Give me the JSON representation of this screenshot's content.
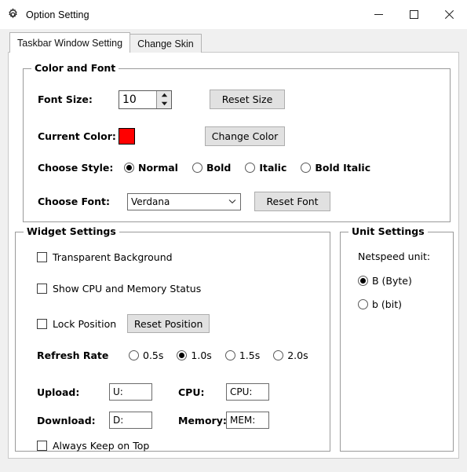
{
  "window": {
    "title": "Option Setting",
    "icon": "gear-icon",
    "controls": {
      "minimize": "minimize-icon",
      "maximize": "maximize-icon",
      "close": "close-icon"
    }
  },
  "tabs": [
    {
      "label": "Taskbar Window Setting",
      "active": true
    },
    {
      "label": "Change Skin",
      "active": false
    }
  ],
  "color_and_font": {
    "group_title": "Color and Font",
    "font_size": {
      "label": "Font Size:",
      "value": "10",
      "reset_button": "Reset Size"
    },
    "current_color": {
      "label": "Current Color:",
      "swatch_color": "#FF0000",
      "change_button": "Change Color"
    },
    "choose_style": {
      "label": "Choose Style:",
      "options": [
        {
          "label": "Normal",
          "selected": true
        },
        {
          "label": "Bold",
          "selected": false
        },
        {
          "label": "Italic",
          "selected": false
        },
        {
          "label": "Bold Italic",
          "selected": false
        }
      ]
    },
    "choose_font": {
      "label": "Choose Font:",
      "value": "Verdana",
      "reset_button": "Reset Font"
    }
  },
  "widget_settings": {
    "group_title": "Widget Settings",
    "transparent_background": {
      "label": "Transparent Background",
      "checked": false
    },
    "show_cpu_memory": {
      "label": "Show CPU and Memory Status",
      "checked": false
    },
    "lock_position": {
      "label": "Lock Position",
      "checked": false
    },
    "reset_position_button": "Reset Position",
    "refresh_rate": {
      "label": "Refresh Rate",
      "options": [
        {
          "label": "0.5s",
          "selected": false
        },
        {
          "label": "1.0s",
          "selected": true
        },
        {
          "label": "1.5s",
          "selected": false
        },
        {
          "label": "2.0s",
          "selected": false
        }
      ]
    },
    "fields": {
      "upload": {
        "label": "Upload:",
        "value": "U:"
      },
      "cpu": {
        "label": "CPU:",
        "value": "CPU:"
      },
      "download": {
        "label": "Download:",
        "value": "D:"
      },
      "memory": {
        "label": "Memory:",
        "value": "MEM:"
      }
    },
    "always_keep_on_top": {
      "label": "Always Keep on Top",
      "checked": false
    }
  },
  "unit_settings": {
    "group_title": "Unit Settings",
    "netspeed_label": "Netspeed unit:",
    "options": [
      {
        "label": "B (Byte)",
        "selected": true
      },
      {
        "label": "b (bit)",
        "selected": false
      }
    ]
  }
}
